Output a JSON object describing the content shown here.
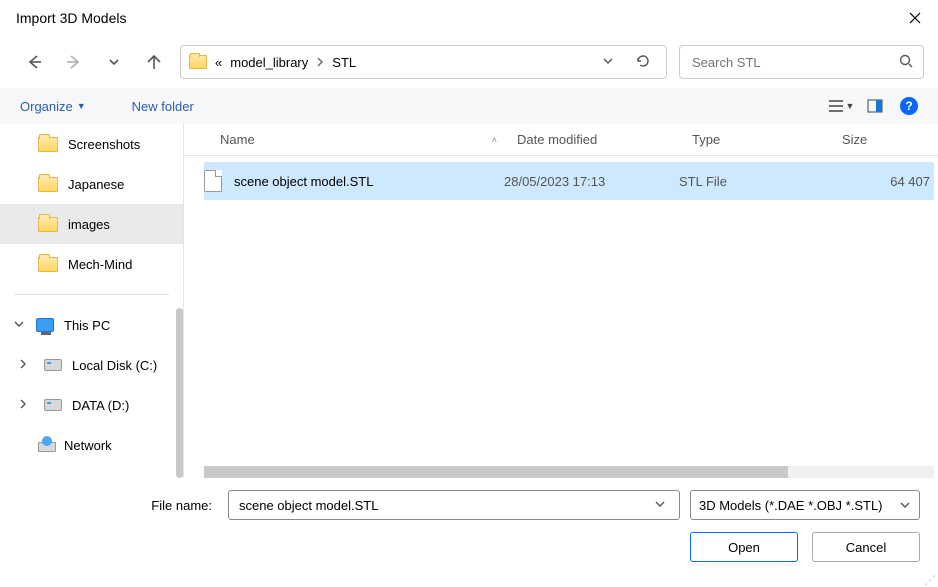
{
  "title": "Import 3D Models",
  "breadcrumb": {
    "prefix": "«",
    "parts": [
      "model_library",
      "STL"
    ]
  },
  "search": {
    "placeholder": "Search STL"
  },
  "toolbar": {
    "organize": "Organize",
    "new_folder": "New folder"
  },
  "tree": {
    "items": [
      {
        "label": "Screenshots",
        "kind": "folder"
      },
      {
        "label": "Japanese",
        "kind": "folder"
      },
      {
        "label": "images",
        "kind": "folder",
        "selected": true
      },
      {
        "label": "Mech-Mind",
        "kind": "folder"
      }
    ],
    "this_pc": "This PC",
    "drives": [
      {
        "label": "Local Disk (C:)"
      },
      {
        "label": "DATA (D:)"
      }
    ],
    "network": "Network"
  },
  "columns": {
    "name": "Name",
    "date": "Date modified",
    "type": "Type",
    "size": "Size"
  },
  "files": [
    {
      "name": "scene object model.STL",
      "date": "28/05/2023 17:13",
      "type": "STL File",
      "size": "64 407",
      "selected": true
    }
  ],
  "footer": {
    "filename_label": "File name:",
    "filename_value": "scene object model.STL",
    "filter": "3D Models (*.DAE *.OBJ *.STL)",
    "open": "Open",
    "cancel": "Cancel"
  }
}
